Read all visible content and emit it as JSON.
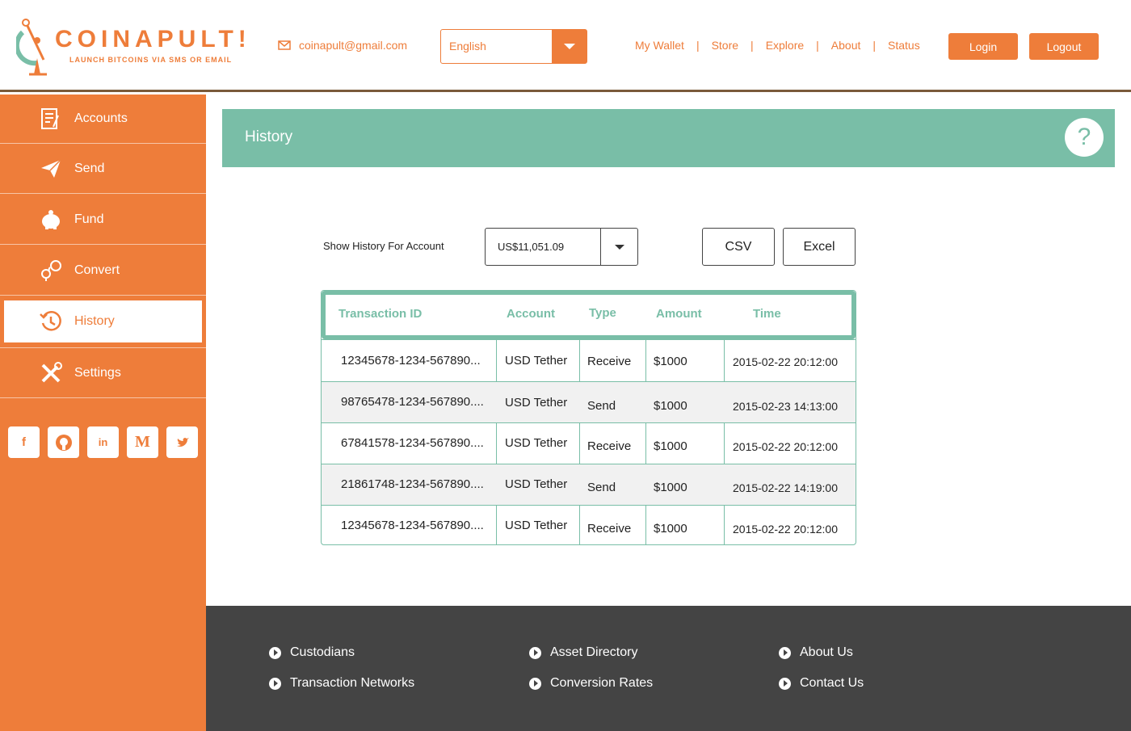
{
  "brand": {
    "name": "COINAPULT!",
    "tagline": "LAUNCH BITCOINS VIA SMS OR EMAIL",
    "accent": "#ee7d3a",
    "teal": "#79bea7"
  },
  "header": {
    "email": "coinapult@gmail.com",
    "language": "English",
    "nav": [
      "My Wallet",
      "Store",
      "Explore",
      "About",
      "Status"
    ],
    "nav_separator": "|",
    "login": "Login",
    "logout": "Logout"
  },
  "sidebar": {
    "items": [
      {
        "label": "Accounts",
        "icon": "accounts-icon"
      },
      {
        "label": "Send",
        "icon": "paper-plane-icon"
      },
      {
        "label": "Fund",
        "icon": "piggy-bank-icon"
      },
      {
        "label": "Convert",
        "icon": "convert-icon"
      },
      {
        "label": "History",
        "icon": "history-icon",
        "active": true
      },
      {
        "label": "Settings",
        "icon": "tools-icon"
      }
    ],
    "social": [
      {
        "icon": "facebook-icon",
        "glyph": "f"
      },
      {
        "icon": "github-icon",
        "glyph": ""
      },
      {
        "icon": "linkedin-icon",
        "glyph": "in"
      },
      {
        "icon": "medium-icon",
        "glyph": "M"
      },
      {
        "icon": "twitter-icon",
        "glyph": ""
      }
    ]
  },
  "main": {
    "title": "History",
    "help": "?",
    "account_label": "Show History For Account",
    "account_value": "US$11,051.09",
    "export_csv": "CSV",
    "export_excel": "Excel",
    "columns": [
      "Transaction ID",
      "Account",
      "Type",
      "Amount",
      "Time"
    ],
    "rows": [
      {
        "id": "12345678-1234-567890...",
        "account": "USD Tether",
        "type": "Receive",
        "amount": "$1000",
        "time": "2015-02-22 20:12:00"
      },
      {
        "id": "98765478-1234-567890....",
        "account": "USD Tether",
        "type": "Send",
        "amount": "$1000",
        "time": "2015-02-23 14:13:00"
      },
      {
        "id": "67841578-1234-567890....",
        "account": "USD Tether",
        "type": "Receive",
        "amount": "$1000",
        "time": "2015-02-22 20:12:00"
      },
      {
        "id": "21861748-1234-567890....",
        "account": "USD Tether",
        "type": "Send",
        "amount": "$1000",
        "time": "2015-02-22 14:19:00"
      },
      {
        "id": "12345678-1234-567890....",
        "account": "USD Tether",
        "type": "Receive",
        "amount": "$1000",
        "time": "2015-02-22 20:12:00"
      }
    ]
  },
  "footer": {
    "links": [
      "Custodians",
      "Transaction Networks",
      "Asset Directory",
      "Conversion Rates",
      "About Us",
      "Contact Us"
    ]
  }
}
